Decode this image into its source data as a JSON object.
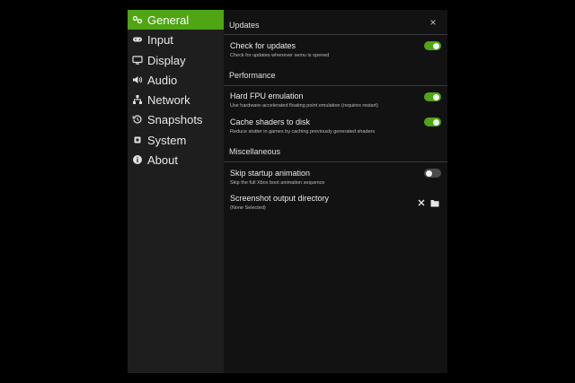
{
  "sidebar": {
    "items": [
      {
        "label": "General",
        "icon": "gamepad-icon",
        "active": true
      },
      {
        "label": "Input",
        "icon": "controller-icon",
        "active": false
      },
      {
        "label": "Display",
        "icon": "monitor-icon",
        "active": false
      },
      {
        "label": "Audio",
        "icon": "speaker-icon",
        "active": false
      },
      {
        "label": "Network",
        "icon": "network-icon",
        "active": false
      },
      {
        "label": "Snapshots",
        "icon": "history-icon",
        "active": false
      },
      {
        "label": "System",
        "icon": "chip-icon",
        "active": false
      },
      {
        "label": "About",
        "icon": "info-icon",
        "active": false
      }
    ]
  },
  "content": {
    "close_label": "×",
    "sections": [
      {
        "title": "Updates",
        "rows": [
          {
            "title": "Check for updates",
            "description": "Check for updates whenever xemu is opened",
            "enabled": true
          }
        ]
      },
      {
        "title": "Performance",
        "rows": [
          {
            "title": "Hard FPU emulation",
            "description": "Use hardware-accelerated floating point emulation (requires restart)",
            "enabled": true
          },
          {
            "title": "Cache shaders to disk",
            "description": "Reduce stutter in games by caching previously generated shaders",
            "enabled": true
          }
        ]
      },
      {
        "title": "Miscellaneous",
        "rows": [
          {
            "title": "Skip startup animation",
            "description": "Skip the full Xbox boot animation sequence",
            "enabled": false
          },
          {
            "title": "Screenshot output directory",
            "description": "(None Selected)",
            "clear_icon": "close-icon",
            "browse_icon": "folder-icon"
          }
        ]
      }
    ]
  },
  "colors": {
    "accent": "#4fa513",
    "sidebar_bg": "#1e1e1e",
    "content_bg": "#121212",
    "toggle_off": "#4a4a4a"
  }
}
